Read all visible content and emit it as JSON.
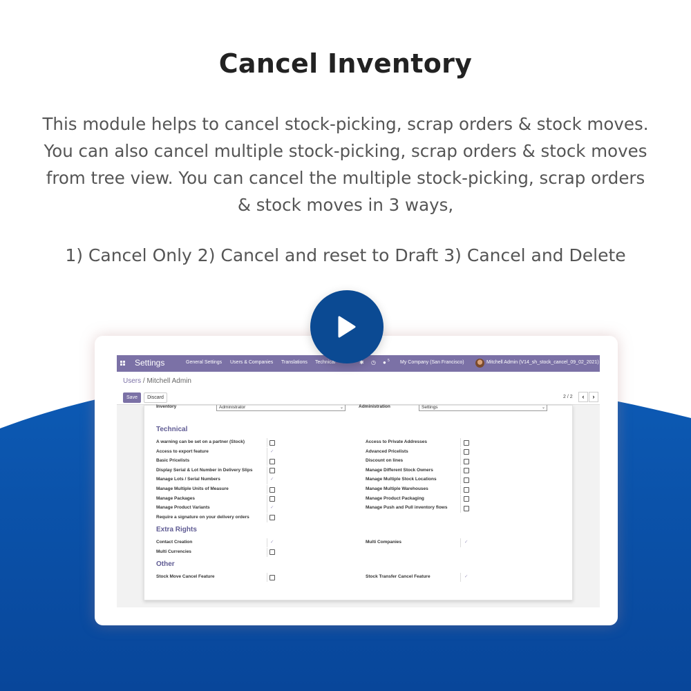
{
  "banner": {
    "title": "Cancel Inventory",
    "description": "This module helps to cancel stock-picking, scrap orders & stock moves. You can also cancel multiple stock-picking, scrap orders & stock moves from tree view. You can cancel the multiple stock-picking, scrap orders & stock moves in 3 ways,",
    "ways": "1) Cancel Only 2) Cancel and reset to Draft 3) Cancel and Delete",
    "play_icon": "play-icon"
  },
  "colors": {
    "wave_blue": "#0b52a8",
    "play_button": "#0b4a93",
    "odoo_purple": "#7b71a6"
  },
  "navbar": {
    "apps_icon": "apps-grid-icon",
    "brand": "Settings",
    "menus": [
      "General Settings",
      "Users & Companies",
      "Translations",
      "Technical"
    ],
    "icons": [
      "bug-icon",
      "clock-icon",
      "chat-icon"
    ],
    "chat_badge": "5",
    "company": "My Company (San Francisco)",
    "user": "Mitchell Admin (V14_sh_stock_cancel_09_02_2021)"
  },
  "control_panel": {
    "breadcrumb_parent": "Users",
    "breadcrumb_sep": "/",
    "breadcrumb_current": "Mitchell Admin",
    "save": "Save",
    "discard": "Discard",
    "pager": "2 / 2",
    "prev": "‹",
    "next": "›"
  },
  "form": {
    "inventory_label": "Inventory",
    "inventory_value": "Administrator",
    "administration_label": "Administration",
    "administration_value": "Settings",
    "sections": [
      {
        "title": "Technical",
        "left": [
          {
            "label": "A warning can be set on a partner (Stock)",
            "checked": false
          },
          {
            "label": "Access to export feature",
            "checked": true
          },
          {
            "label": "Basic Pricelists",
            "checked": false
          },
          {
            "label": "Display Serial & Lot Number in Delivery Slips",
            "checked": false
          },
          {
            "label": "Manage Lots / Serial Numbers",
            "checked": true
          },
          {
            "label": "Manage Multiple Units of Measure",
            "checked": false
          },
          {
            "label": "Manage Packages",
            "checked": false
          },
          {
            "label": "Manage Product Variants",
            "checked": true
          },
          {
            "label": "Require a signature on your delivery orders",
            "checked": false
          }
        ],
        "right": [
          {
            "label": "Access to Private Addresses",
            "checked": false
          },
          {
            "label": "Advanced Pricelists",
            "checked": false
          },
          {
            "label": "Discount on lines",
            "checked": false
          },
          {
            "label": "Manage Different Stock Owners",
            "checked": false
          },
          {
            "label": "Manage Multiple Stock Locations",
            "checked": false
          },
          {
            "label": "Manage Multiple Warehouses",
            "checked": false
          },
          {
            "label": "Manage Product Packaging",
            "checked": false
          },
          {
            "label": "Manage Push and Pull inventory flows",
            "checked": false
          }
        ]
      },
      {
        "title": "Extra Rights",
        "left": [
          {
            "label": "Contact Creation",
            "checked": true
          },
          {
            "label": "Multi Currencies",
            "checked": false
          }
        ],
        "right": [
          {
            "label": "Multi Companies",
            "checked": true
          }
        ]
      },
      {
        "title": "Other",
        "left": [
          {
            "label": "Stock Move Cancel Feature",
            "checked": false
          }
        ],
        "right": [
          {
            "label": "Stock Transfer Cancel Feature",
            "checked": true
          }
        ]
      }
    ]
  }
}
